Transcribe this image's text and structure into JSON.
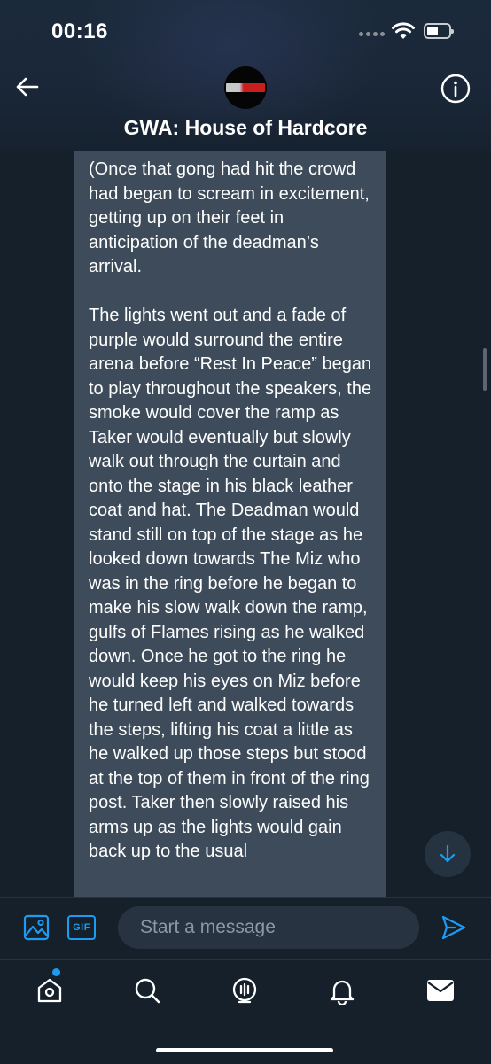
{
  "status_bar": {
    "time": "00:16"
  },
  "conversation": {
    "title": "GWA: House of Hardcore"
  },
  "message": {
    "paragraphs": [
      "(Once that gong had hit the crowd had began to scream in excitement, getting up on their feet in anticipation of the deadman’s arrival.",
      "The lights went out and a fade of purple would surround the entire arena before “Rest In Peace” began to play throughout the speakers, the smoke would cover the ramp as Taker would eventually but slowly walk out through the curtain and onto the stage in his black leather coat and hat. The Deadman would stand still on top of the stage as he looked down towards The Miz who was in the ring before he began to make his slow walk down the ramp, gulfs of Flames rising as he walked down. Once he got to the ring he would keep his eyes on Miz before he turned left and walked towards the steps, lifting his coat a little as he walked up those steps but stood at the top of them in front of the ring post. Taker then slowly raised his arms up as the lights would gain back up to the usual"
    ]
  },
  "composer": {
    "gif_label": "GIF",
    "placeholder": "Start a message"
  },
  "icons": {
    "back": "arrow-left-icon",
    "info": "info-icon",
    "scroll_down": "arrow-down-icon",
    "media": "image-icon",
    "send": "send-icon",
    "tabs": [
      "home-icon",
      "search-icon",
      "spaces-icon",
      "notifications-icon",
      "messages-icon"
    ]
  },
  "colors": {
    "accent": "#1d9bf0",
    "background": "#15202b",
    "bubble": "#3d4b5b"
  }
}
